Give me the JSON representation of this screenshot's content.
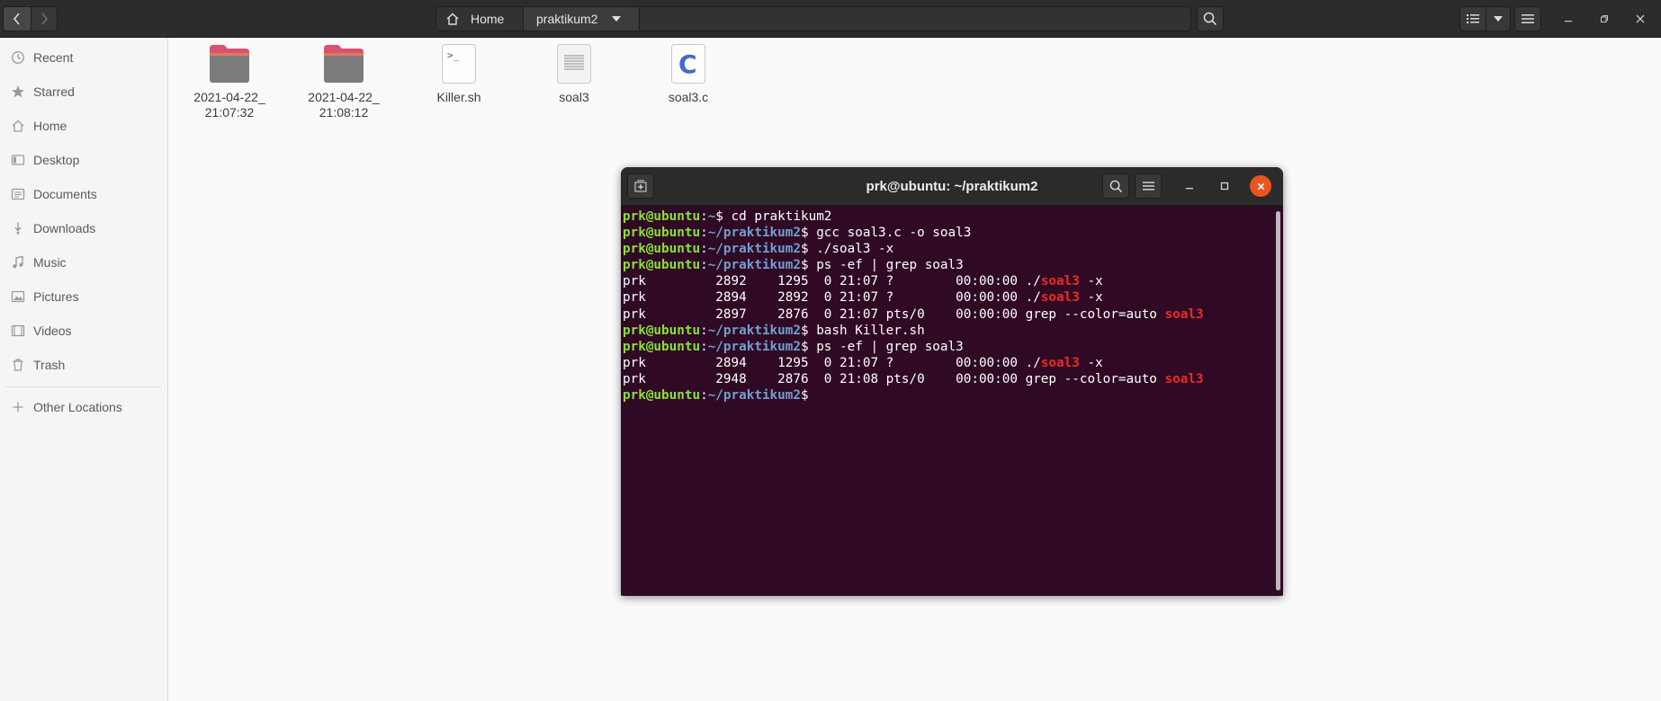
{
  "header": {
    "breadcrumbs": [
      {
        "label": "Home"
      },
      {
        "label": "praktikum2"
      }
    ]
  },
  "sidebar": {
    "items": [
      {
        "label": "Recent",
        "icon": "clock-icon"
      },
      {
        "label": "Starred",
        "icon": "star-icon"
      },
      {
        "label": "Home",
        "icon": "home-icon"
      },
      {
        "label": "Desktop",
        "icon": "desktop-icon"
      },
      {
        "label": "Documents",
        "icon": "document-icon"
      },
      {
        "label": "Downloads",
        "icon": "download-icon"
      },
      {
        "label": "Music",
        "icon": "music-icon"
      },
      {
        "label": "Pictures",
        "icon": "picture-icon"
      },
      {
        "label": "Videos",
        "icon": "video-icon"
      },
      {
        "label": "Trash",
        "icon": "trash-icon"
      }
    ],
    "other_locations": "Other Locations"
  },
  "files": [
    {
      "name": "2021-04-22_\n21:07:32",
      "type": "folder",
      "icon": "folder-icon"
    },
    {
      "name": "2021-04-22_\n21:08:12",
      "type": "folder",
      "icon": "folder-icon"
    },
    {
      "name": "Killer.sh",
      "type": "shell-script",
      "icon": "script-icon"
    },
    {
      "name": "soal3",
      "type": "binary",
      "icon": "text-file-icon"
    },
    {
      "name": "soal3.c",
      "type": "c-source",
      "icon": "c-source-icon"
    }
  ],
  "terminal": {
    "title": "prk@ubuntu: ~/praktikum2",
    "user_host": "prk@ubuntu",
    "lines": [
      [
        {
          "t": "prk@ubuntu",
          "c": "user"
        },
        {
          "t": ":"
        },
        {
          "t": "~",
          "c": "path"
        },
        {
          "t": "$ cd praktikum2"
        }
      ],
      [
        {
          "t": "prk@ubuntu",
          "c": "user"
        },
        {
          "t": ":"
        },
        {
          "t": "~/praktikum2",
          "c": "path"
        },
        {
          "t": "$ gcc soal3.c -o soal3"
        }
      ],
      [
        {
          "t": "prk@ubuntu",
          "c": "user"
        },
        {
          "t": ":"
        },
        {
          "t": "~/praktikum2",
          "c": "path"
        },
        {
          "t": "$ ./soal3 -x"
        }
      ],
      [
        {
          "t": "prk@ubuntu",
          "c": "user"
        },
        {
          "t": ":"
        },
        {
          "t": "~/praktikum2",
          "c": "path"
        },
        {
          "t": "$ ps -ef | grep soal3"
        }
      ],
      [
        {
          "t": "prk         2892    1295  0 21:07 ?        00:00:00 ./"
        },
        {
          "t": "soal3",
          "c": "match"
        },
        {
          "t": " -x"
        }
      ],
      [
        {
          "t": "prk         2894    2892  0 21:07 ?        00:00:00 ./"
        },
        {
          "t": "soal3",
          "c": "match"
        },
        {
          "t": " -x"
        }
      ],
      [
        {
          "t": "prk         2897    2876  0 21:07 pts/0    00:00:00 grep --color=auto "
        },
        {
          "t": "soal3",
          "c": "match"
        }
      ],
      [
        {
          "t": "prk@ubuntu",
          "c": "user"
        },
        {
          "t": ":"
        },
        {
          "t": "~/praktikum2",
          "c": "path"
        },
        {
          "t": "$ bash Killer.sh"
        }
      ],
      [
        {
          "t": "prk@ubuntu",
          "c": "user"
        },
        {
          "t": ":"
        },
        {
          "t": "~/praktikum2",
          "c": "path"
        },
        {
          "t": "$ ps -ef | grep soal3"
        }
      ],
      [
        {
          "t": "prk         2894    1295  0 21:07 ?        00:00:00 ./"
        },
        {
          "t": "soal3",
          "c": "match"
        },
        {
          "t": " -x"
        }
      ],
      [
        {
          "t": "prk         2948    2876  0 21:08 pts/0    00:00:00 grep --color=auto "
        },
        {
          "t": "soal3",
          "c": "match"
        }
      ],
      [
        {
          "t": "prk@ubuntu",
          "c": "user"
        },
        {
          "t": ":"
        },
        {
          "t": "~/praktikum2",
          "c": "path"
        },
        {
          "t": "$ "
        }
      ]
    ]
  },
  "colors": {
    "terminal_bg": "#300a24",
    "prompt_user": "#8ae234",
    "prompt_path": "#729fcf",
    "grep_match": "#ef2929",
    "close_button": "#e9541f",
    "folder": "#d9536f"
  }
}
